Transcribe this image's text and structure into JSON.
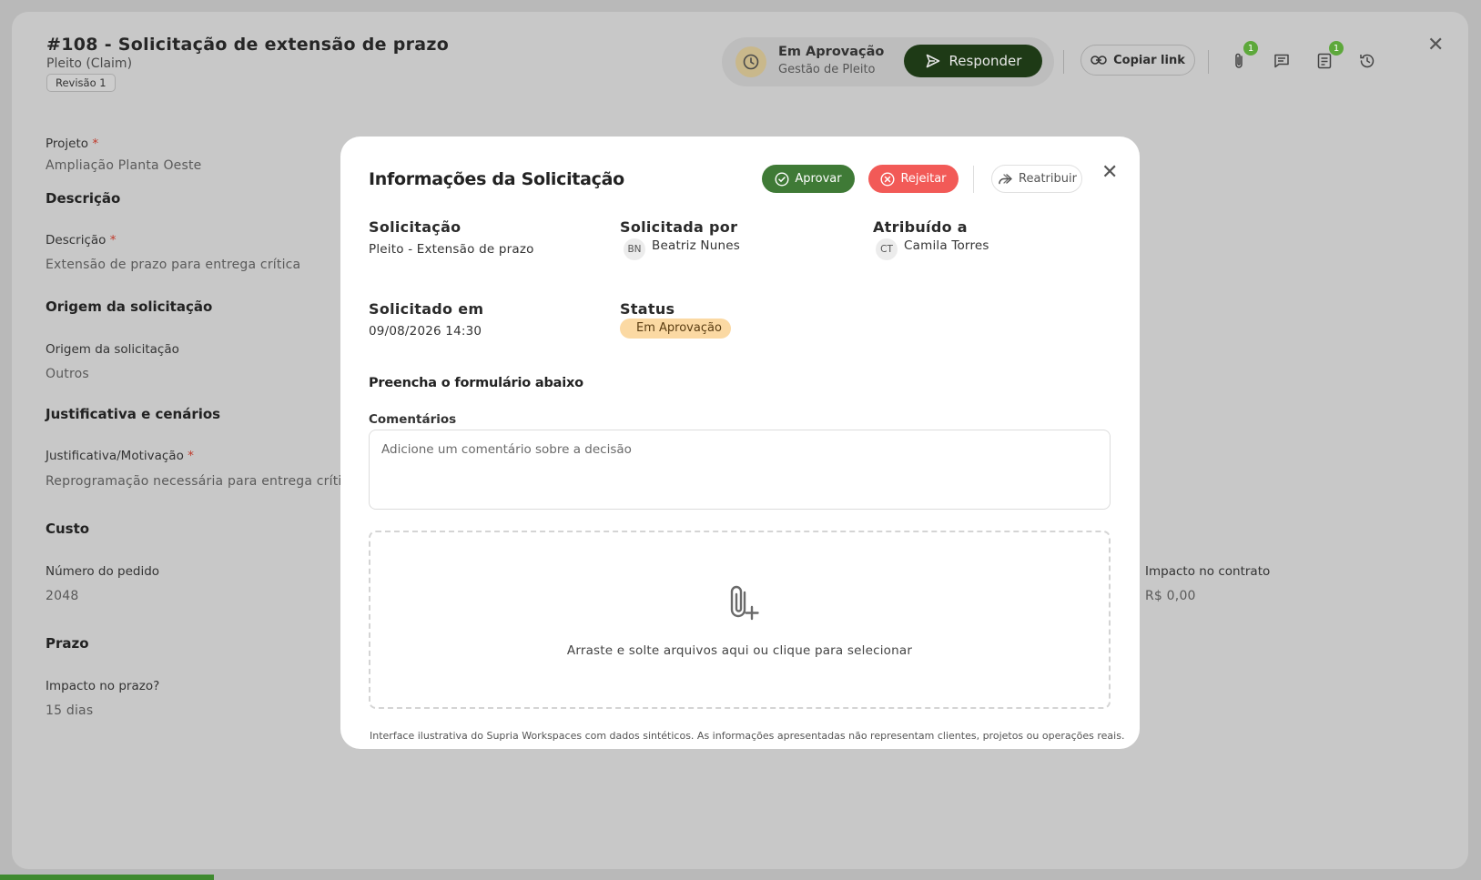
{
  "header": {
    "title": "#108 - Solicitação de extensão de prazo",
    "subtitle": "Pleito (Claim)",
    "revision": "Revisão 1",
    "status_label": "Em Aprovação",
    "status_sub": "Gestão de Pleito",
    "respond_label": "Responder",
    "copy_link_label": "Copiar link",
    "attachments_badge": "1",
    "tasks_badge": "1"
  },
  "left_panel": {
    "project_label": "Projeto",
    "project_value": "Ampliação Planta Oeste",
    "section_description": "Descrição",
    "description_label": "Descrição",
    "description_value": "Extensão de prazo para entrega crítica",
    "section_origin": "Origem da solicitação",
    "origin_label": "Origem da solicitação",
    "origin_value": "Outros",
    "section_justification": "Justificativa e cenários",
    "justification_label": "Justificativa/Motivação",
    "justification_value": "Reprogramação necessária para entrega crítica",
    "section_cost": "Custo",
    "order_label": "Número do pedido",
    "order_value": "2048",
    "section_deadline": "Prazo",
    "deadline_label": "Impacto no prazo?",
    "deadline_value": "15 dias",
    "contract_label": "Impacto no contrato",
    "contract_value": "R$ 0,00",
    "required_mark": "*"
  },
  "modal": {
    "title": "Informações da Solicitação",
    "approve_label": "Aprovar",
    "reject_label": "Rejeitar",
    "reassign_label": "Reatribuir",
    "request_heading": "Solicitação",
    "request_value": "Pleito - Extensão de prazo",
    "requested_by_heading": "Solicitada por",
    "requested_by_initials": "BN",
    "requested_by_name": "Beatriz Nunes",
    "assigned_heading": "Atribuído a",
    "assigned_initials": "CT",
    "assigned_name": "Camila Torres",
    "requested_at_heading": "Solicitado em",
    "requested_at_value": "09/08/2026 14:30",
    "status_heading": "Status",
    "status_value": "Em Aprovação",
    "form_heading": "Preencha o formulário abaixo",
    "comments_label": "Comentários",
    "comments_placeholder": "Adicione um comentário sobre a decisão",
    "dropzone_text": "Arraste e solte arquivos aqui ou clique para selecionar",
    "disclaimer": "Interface ilustrativa do Supria Workspaces com dados sintéticos. As informações apresentadas não representam clientes, projetos ou operações reais."
  },
  "colors": {
    "approve": "#3f7a36",
    "reject": "#f25a57",
    "respond": "#1e3a16",
    "status_badge": "#fbd9a3",
    "notification_badge": "#5da83b"
  }
}
